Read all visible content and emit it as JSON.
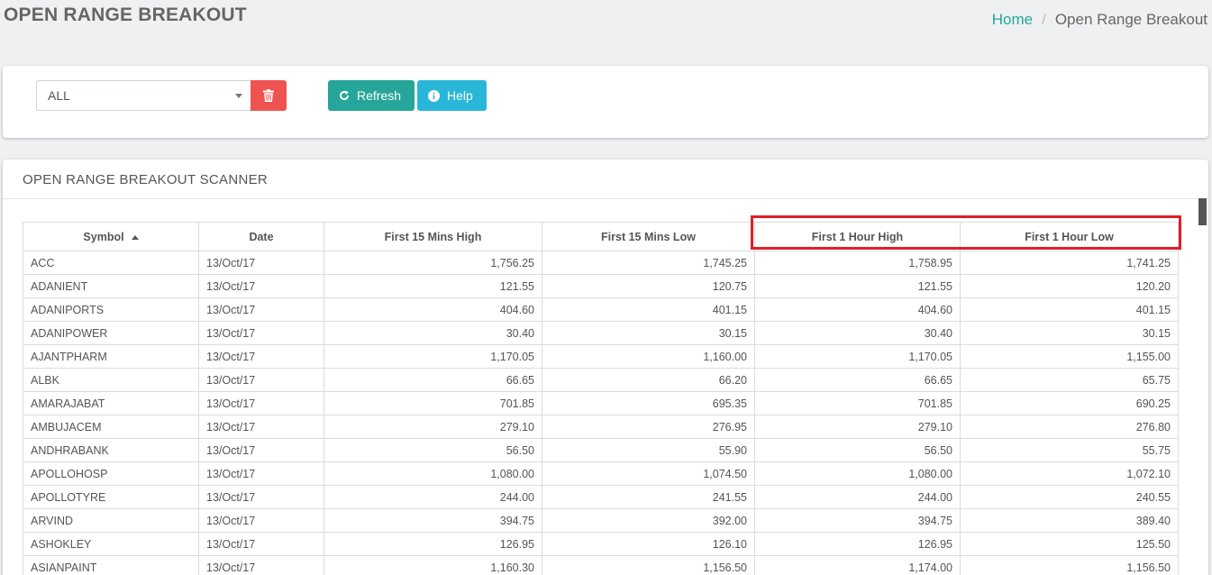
{
  "page": {
    "title": "OPEN RANGE BREAKOUT"
  },
  "breadcrumb": {
    "home": "Home",
    "separator": "/",
    "current": "Open Range Breakout"
  },
  "filter": {
    "selected": "ALL",
    "refresh_label": "Refresh",
    "help_label": "Help"
  },
  "scanner": {
    "title": "OPEN RANGE BREAKOUT SCANNER",
    "columns": [
      "Symbol",
      "Date",
      "First 15 Mins High",
      "First 15 Mins Low",
      "First 1 Hour High",
      "First 1 Hour Low"
    ],
    "rows": [
      [
        "ACC",
        "13/Oct/17",
        "1,756.25",
        "1,745.25",
        "1,758.95",
        "1,741.25"
      ],
      [
        "ADANIENT",
        "13/Oct/17",
        "121.55",
        "120.75",
        "121.55",
        "120.20"
      ],
      [
        "ADANIPORTS",
        "13/Oct/17",
        "404.60",
        "401.15",
        "404.60",
        "401.15"
      ],
      [
        "ADANIPOWER",
        "13/Oct/17",
        "30.40",
        "30.15",
        "30.40",
        "30.15"
      ],
      [
        "AJANTPHARM",
        "13/Oct/17",
        "1,170.05",
        "1,160.00",
        "1,170.05",
        "1,155.00"
      ],
      [
        "ALBK",
        "13/Oct/17",
        "66.65",
        "66.20",
        "66.65",
        "65.75"
      ],
      [
        "AMARAJABAT",
        "13/Oct/17",
        "701.85",
        "695.35",
        "701.85",
        "690.25"
      ],
      [
        "AMBUJACEM",
        "13/Oct/17",
        "279.10",
        "276.95",
        "279.10",
        "276.80"
      ],
      [
        "ANDHRABANK",
        "13/Oct/17",
        "56.50",
        "55.90",
        "56.50",
        "55.75"
      ],
      [
        "APOLLOHOSP",
        "13/Oct/17",
        "1,080.00",
        "1,074.50",
        "1,080.00",
        "1,072.10"
      ],
      [
        "APOLLOTYRE",
        "13/Oct/17",
        "244.00",
        "241.55",
        "244.00",
        "240.55"
      ],
      [
        "ARVIND",
        "13/Oct/17",
        "394.75",
        "392.00",
        "394.75",
        "389.40"
      ],
      [
        "ASHOKLEY",
        "13/Oct/17",
        "126.95",
        "126.10",
        "126.95",
        "125.50"
      ],
      [
        "ASIANPAINT",
        "13/Oct/17",
        "1,160.30",
        "1,156.50",
        "1,174.00",
        "1,156.50"
      ]
    ]
  },
  "colors": {
    "accent": "#26a69a",
    "danger": "#ef5350",
    "info": "#29b6d8",
    "highlight": "#e01e26"
  }
}
